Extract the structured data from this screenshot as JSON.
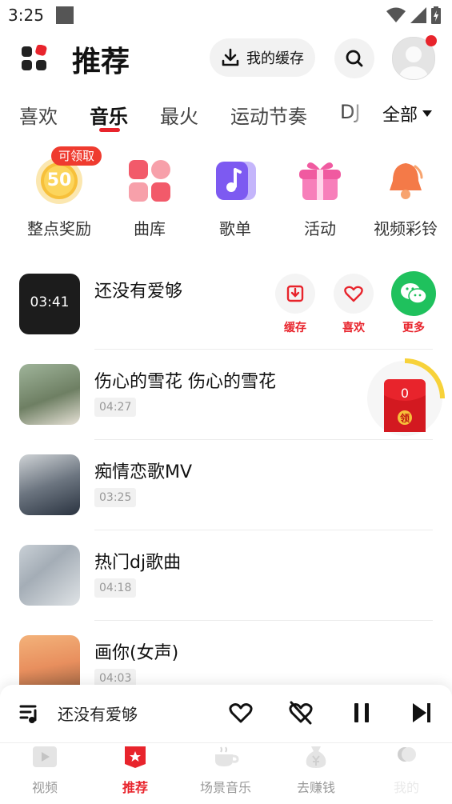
{
  "status_bar": {
    "time": "3:25"
  },
  "header": {
    "title": "推荐",
    "cache_label": "我的缓存"
  },
  "tabs": [
    {
      "label": "喜欢"
    },
    {
      "label": "音乐"
    },
    {
      "label": "最火"
    },
    {
      "label": "运动节奏"
    },
    {
      "label": "DJ"
    }
  ],
  "tabs_all_label": "全部",
  "categories": [
    {
      "label": "整点奖励",
      "badge": "可领取",
      "value": "50"
    },
    {
      "label": "曲库"
    },
    {
      "label": "歌单"
    },
    {
      "label": "活动"
    },
    {
      "label": "视频彩铃"
    }
  ],
  "songs": [
    {
      "title": "还没有爱够",
      "thumb_text": "03:41"
    },
    {
      "title": "伤心的雪花 伤心的雪花",
      "duration": "04:27"
    },
    {
      "title": "痴情恋歌MV",
      "duration": "03:25"
    },
    {
      "title": "热门dj歌曲",
      "duration": "04:18"
    },
    {
      "title": "画你(女声)",
      "duration": "04:03"
    }
  ],
  "song_actions": {
    "cache": "缓存",
    "like": "喜欢",
    "more": "更多"
  },
  "reward_widget": {
    "count": "0",
    "claim": "领"
  },
  "player": {
    "title": "还没有爱够"
  },
  "bottom_nav": [
    {
      "label": "视频"
    },
    {
      "label": "推荐"
    },
    {
      "label": "场景音乐"
    },
    {
      "label": "去赚钱"
    },
    {
      "label": "我的"
    }
  ],
  "colors": {
    "accent": "#e8242c",
    "green": "#1fc15d"
  }
}
